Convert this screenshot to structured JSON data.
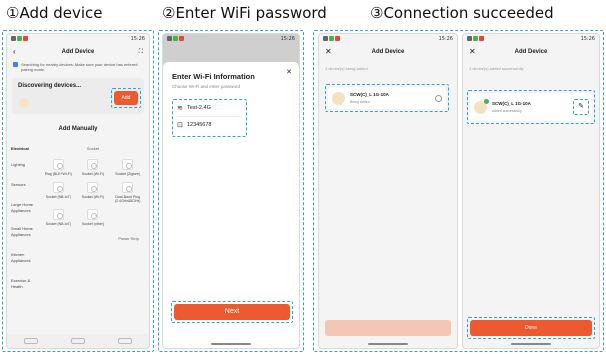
{
  "steps": [
    {
      "label": "①Add device"
    },
    {
      "label": "②Enter WiFi password"
    },
    {
      "label": "③Connection succeeded"
    }
  ],
  "status_time": "15:26",
  "screen1": {
    "back": "‹",
    "title": "Add Device",
    "tip": "Searching for nearby devices. Make sure your device has entered pairing mode.",
    "discovering": "Discovering devices...",
    "add_button": "Add",
    "manual_title": "Add Manually",
    "category_header": "Electrical",
    "column_header": "Socket",
    "categories": [
      "Lighting",
      "Sensors",
      "Large Home Appliances",
      "Small Home Appliances",
      "Kitchen Appliances",
      "Exercise & Health"
    ],
    "tiles": [
      {
        "label": "Plug (BLE+Wi-Fi)"
      },
      {
        "label": "Socket (Wi-Fi)"
      },
      {
        "label": "Socket (Zigbee)"
      },
      {
        "label": "Socket (NB-IoT)"
      },
      {
        "label": "Socket (Wi-Fi)"
      },
      {
        "label": "Dual-Band Plug (2.4GHz&5GHz)"
      },
      {
        "label": "Socket (NB-IoT)"
      },
      {
        "label": "Socket (other)"
      }
    ],
    "footer_group": "Power Strip"
  },
  "screen2": {
    "title": "Enter Wi-Fi Information",
    "subtitle": "Choose Wi-Fi and enter password",
    "wifi_name": "Test-2.4G",
    "password": "12345678",
    "next_button": "Next"
  },
  "screen3a": {
    "title": "Add Device",
    "status_line": "1 device(s) being added",
    "device_name": "SCW(C)_L 1G-10A",
    "device_status": "Being added"
  },
  "screen3b": {
    "title": "Add Device",
    "status_line": "1 device(s) added successfully",
    "device_name": "SCW(C)_L 1G-10A",
    "device_status": "added successfully",
    "done_button": "Done"
  },
  "colors": {
    "accent": "#ee5a2f",
    "highlight": "#2aa6d6"
  }
}
